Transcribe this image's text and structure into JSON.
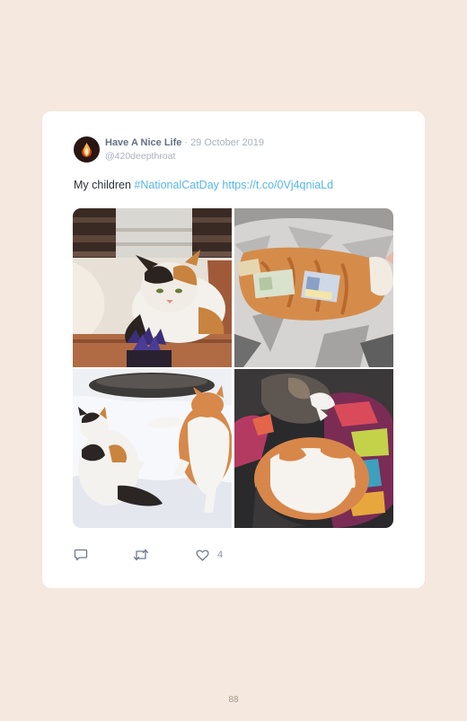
{
  "tweet": {
    "display_name": "Have A Nice Life",
    "separator": "·",
    "date": "29 October 2019",
    "handle": "@420deepthroat",
    "text": "My children",
    "hashtag": "#NationalCatDay",
    "link": "https://t.co/0Vj4qniaLd",
    "likes": "4",
    "photos": [
      "calico-cat-photo",
      "orange-cat-with-money-photo",
      "cats-in-snow-photo",
      "cats-on-blanket-photo"
    ]
  },
  "footer": {
    "page_number": "88"
  },
  "colors": {
    "page_background": "#f4e8df",
    "card_background": "#ffffff",
    "name": "#637185",
    "muted": "#a8b1bd",
    "link": "#58b6e6"
  }
}
